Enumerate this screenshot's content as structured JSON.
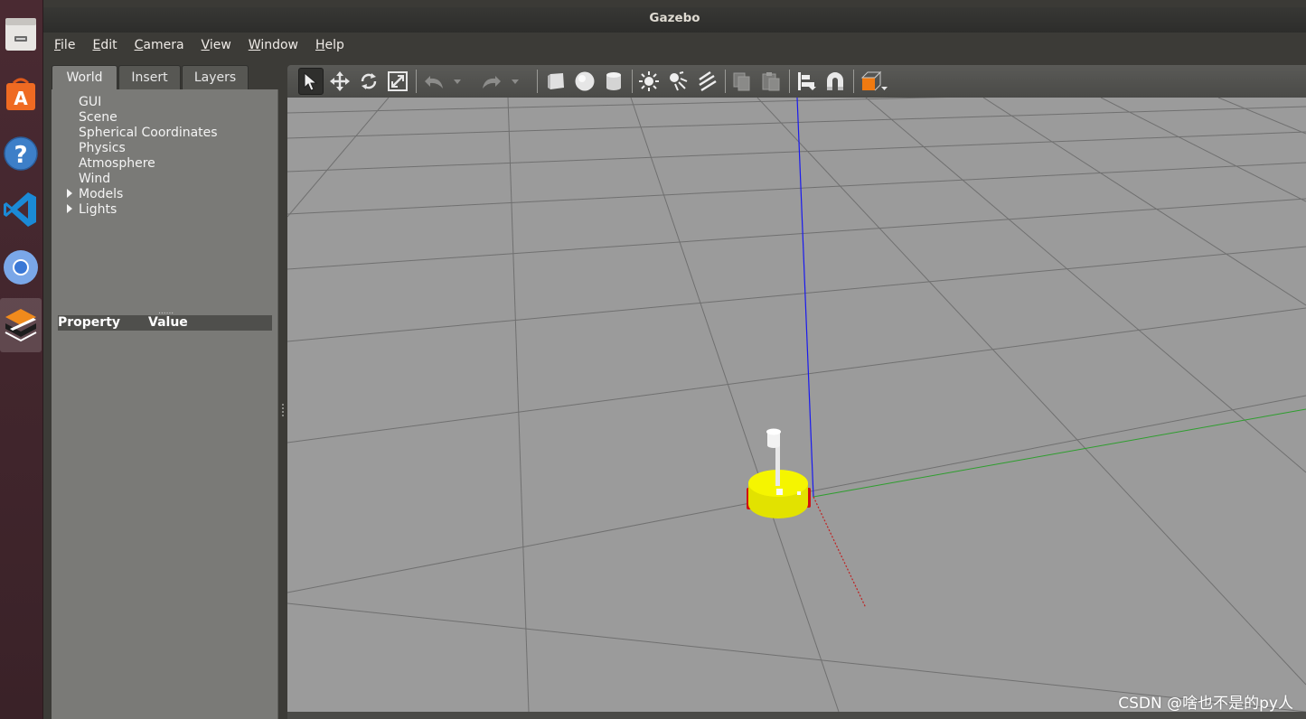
{
  "window": {
    "title": "Gazebo"
  },
  "launcher": {
    "items": [
      {
        "name": "files-icon"
      },
      {
        "name": "software-center-icon"
      },
      {
        "name": "help-icon"
      },
      {
        "name": "vscode-icon"
      },
      {
        "name": "chromium-icon"
      },
      {
        "name": "gazebo-icon",
        "active": true
      }
    ]
  },
  "menubar": {
    "items": [
      "File",
      "Edit",
      "Camera",
      "View",
      "Window",
      "Help"
    ]
  },
  "left_panel": {
    "tabs": [
      "World",
      "Insert",
      "Layers"
    ],
    "active_tab": "World",
    "tree": [
      {
        "label": "GUI",
        "expandable": false
      },
      {
        "label": "Scene",
        "expandable": false
      },
      {
        "label": "Spherical Coordinates",
        "expandable": false
      },
      {
        "label": "Physics",
        "expandable": false
      },
      {
        "label": "Atmosphere",
        "expandable": false
      },
      {
        "label": "Wind",
        "expandable": false
      },
      {
        "label": "Models",
        "expandable": true
      },
      {
        "label": "Lights",
        "expandable": true
      }
    ],
    "splitter_handle": "......",
    "property_header": {
      "property": "Property",
      "value": "Value"
    }
  },
  "toolbar": {
    "tools": [
      "select-mode-icon",
      "translate-mode-icon",
      "rotate-mode-icon",
      "scale-mode-icon",
      "undo-icon",
      "undo-history-icon",
      "redo-icon",
      "redo-history-icon",
      "box-shape-icon",
      "sphere-shape-icon",
      "cylinder-shape-icon",
      "point-light-icon",
      "spot-light-icon",
      "directional-light-icon",
      "copy-icon",
      "paste-icon",
      "align-icon",
      "snap-icon",
      "view-angle-icon"
    ],
    "selected_tool": "select-mode-icon"
  },
  "scene": {
    "background_color": "#9b9b9b",
    "grid_color": "#6e6e6e",
    "axis_colors": {
      "x": "#c02020",
      "y": "#2e9e2e",
      "z": "#1a1aee"
    },
    "robot_body_color": "#f0f000",
    "robot_wheel_color": "#d01010"
  },
  "watermark": "CSDN @啥也不是的py人"
}
